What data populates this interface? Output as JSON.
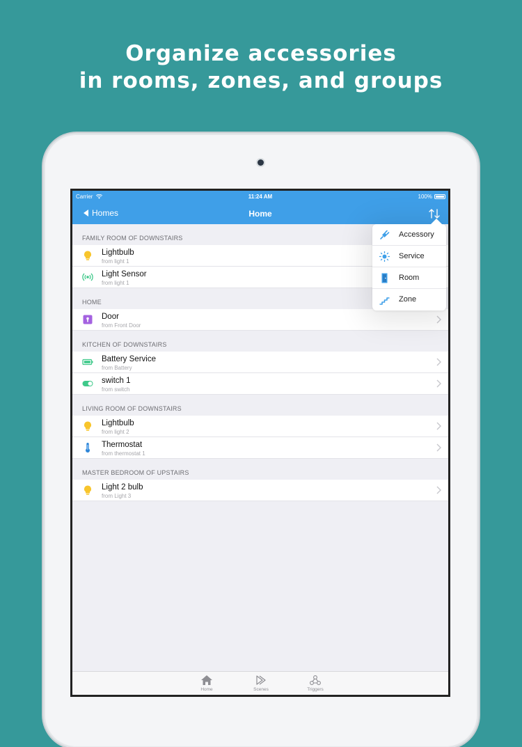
{
  "headline": {
    "line1": "Organize accessories",
    "line2": "in rooms, zones, and groups"
  },
  "statusbar": {
    "carrier": "Carrier",
    "time": "11:24 AM",
    "battery": "100%"
  },
  "navbar": {
    "back_label": "Homes",
    "title": "Home"
  },
  "sections": [
    {
      "header": "FAMILY ROOM OF DOWNSTAIRS",
      "rows": [
        {
          "title": "Lightbulb",
          "subtitle": "from light 1",
          "icon": "lightbulb-icon"
        },
        {
          "title": "Light Sensor",
          "subtitle": "from light 1",
          "icon": "light-sensor-icon"
        }
      ]
    },
    {
      "header": "HOME",
      "rows": [
        {
          "title": "Door",
          "subtitle": "from Front Door",
          "icon": "door-lock-icon"
        }
      ]
    },
    {
      "header": "KITCHEN OF DOWNSTAIRS",
      "rows": [
        {
          "title": "Battery Service",
          "subtitle": "from Battery",
          "icon": "battery-icon"
        },
        {
          "title": "switch 1",
          "subtitle": "from switch",
          "icon": "switch-icon"
        }
      ]
    },
    {
      "header": "LIVING ROOM OF DOWNSTAIRS",
      "rows": [
        {
          "title": "Lightbulb",
          "subtitle": "from light 2",
          "icon": "lightbulb-icon"
        },
        {
          "title": "Thermostat",
          "subtitle": "from thermostat 1",
          "icon": "thermometer-icon"
        }
      ]
    },
    {
      "header": "MASTER BEDROOM OF UPSTAIRS",
      "rows": [
        {
          "title": "Light 2 bulb",
          "subtitle": "from Light 3",
          "icon": "lightbulb-icon"
        }
      ]
    }
  ],
  "popover": {
    "items": [
      {
        "label": "Accessory",
        "icon": "plug-icon"
      },
      {
        "label": "Service",
        "icon": "sun-icon"
      },
      {
        "label": "Room",
        "icon": "door-icon"
      },
      {
        "label": "Zone",
        "icon": "stairs-icon"
      }
    ]
  },
  "tabbar": {
    "items": [
      {
        "label": "Home",
        "icon": "house-icon"
      },
      {
        "label": "Scenes",
        "icon": "scenes-icon"
      },
      {
        "label": "Triggers",
        "icon": "triggers-icon"
      }
    ]
  },
  "colors": {
    "background": "#36999a",
    "navbar": "#3f9fe8",
    "lightbulb": "#f8c52c",
    "sensor": "#3fc98a",
    "door": "#a462e0",
    "battery": "#3fc98a",
    "thermometer": "#2f86d8"
  }
}
